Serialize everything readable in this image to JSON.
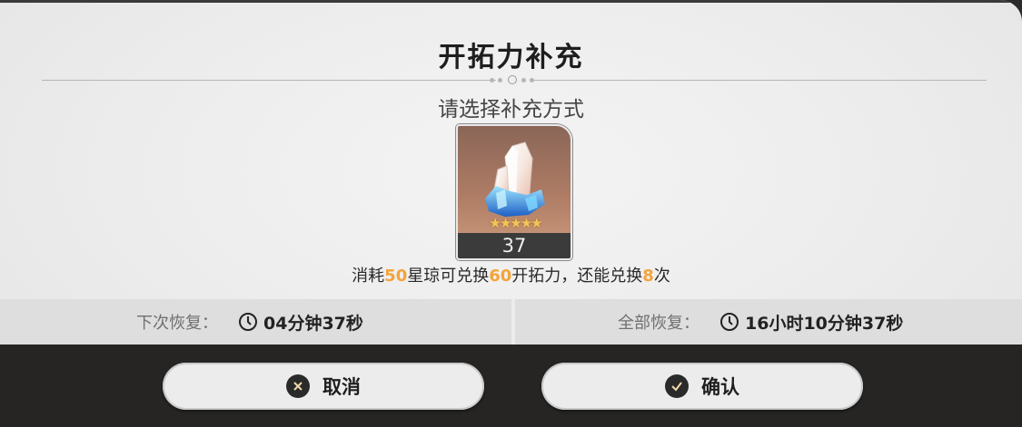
{
  "dialog": {
    "title": "开拓力补充",
    "subtitle": "请选择补充方式"
  },
  "item": {
    "icon": "stellar-jade-icon",
    "stars": "★★★★★",
    "count": "37"
  },
  "description": {
    "part1": "消耗",
    "cost": "50",
    "part2": "星琼可兑换",
    "gain": "60",
    "part3": "开拓力，还能兑换",
    "remaining": "8",
    "part4": "次",
    "highlight_color": "#f3a43a"
  },
  "recovery": {
    "next_label": "下次恢复：",
    "next_value": "04分钟37秒",
    "full_label": "全部恢复：",
    "full_value": "16小时10分钟37秒",
    "icon": "clock-icon"
  },
  "buttons": {
    "cancel_label": "取消",
    "cancel_icon": "close-icon",
    "confirm_label": "确认",
    "confirm_icon": "check-icon"
  }
}
